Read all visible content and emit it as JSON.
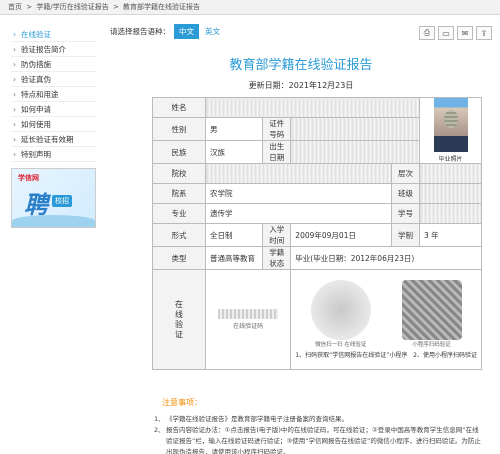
{
  "breadcrumb": {
    "home": "首页",
    "sep": ">",
    "section": "学籍/学历在线验证报告",
    "current": "教育部学籍在线验证报告"
  },
  "sidebar": {
    "items": [
      {
        "label": "在线验证",
        "active": true
      },
      {
        "label": "验证报告简介",
        "active": false
      },
      {
        "label": "防伪措施",
        "active": false
      },
      {
        "label": "验证真伪",
        "active": false
      },
      {
        "label": "特点和用途",
        "active": false
      },
      {
        "label": "如何申请",
        "active": false
      },
      {
        "label": "如何使用",
        "active": false
      },
      {
        "label": "延长验证有效期",
        "active": false
      },
      {
        "label": "特别声明",
        "active": false
      }
    ],
    "ad": {
      "logo": "学信网",
      "big": "聘",
      "tag": "校招",
      "accent": "#2a7fc8"
    }
  },
  "langbar": {
    "label": "请选择报告语种：",
    "zh": "中文",
    "en": "英文"
  },
  "tools": [
    "printer-icon",
    "download-icon",
    "mail-icon",
    "share-icon"
  ],
  "report": {
    "title": "教育部学籍在线验证报告",
    "date": "更新日期：2021年12月23日",
    "title_color": "#2a9bd6"
  },
  "info": {
    "name_label": "姓名",
    "gender_label": "性别",
    "gender": "男",
    "id_label": "证件号码",
    "ethnicity_label": "民族",
    "ethnicity": "汉族",
    "birth_label": "出生日期",
    "photo_caption": "毕业照片",
    "school_label": "院校",
    "level_label": "层次",
    "dept_label": "院系",
    "dept": "农学院",
    "class_label": "班级",
    "major_label": "专业",
    "major": "遗传学",
    "studentno_label": "学号",
    "form_label": "形式",
    "form": "全日制",
    "enroll_label": "入学时间",
    "enroll": "2009年09月01日",
    "duration_label": "学制",
    "duration": "3 年",
    "type_label": "类型",
    "type": "普通高等教育",
    "status_label": "学籍状态",
    "status": "毕业(毕业日期：2012年06月23日)"
  },
  "verify": {
    "label": "在线验证",
    "code_caption": "在线验证码",
    "qr1_caption": "微信扫一扫 在线验证",
    "qr2_caption": "小程序扫码验证",
    "step1": "1、扫码获取“学信网报告在线验证”小程序",
    "step2": "2、使用小程序扫码验证"
  },
  "notes": {
    "title": "注意事项：",
    "items": [
      "《学籍在线验证报告》是教育部学籍电子注册备案的查询结果。",
      "报告内容验证办法：①点击报告(电子版)中的在线验证码，可在线验证；②登录中国高等教育学生信息网“在线验证报告”栏，输入在线验证码进行验证；③使用“学信网报告在线验证”的微信小程序，进行扫码验证。为防止出现伪造报告，请使用该小程序扫码验证。"
    ]
  }
}
